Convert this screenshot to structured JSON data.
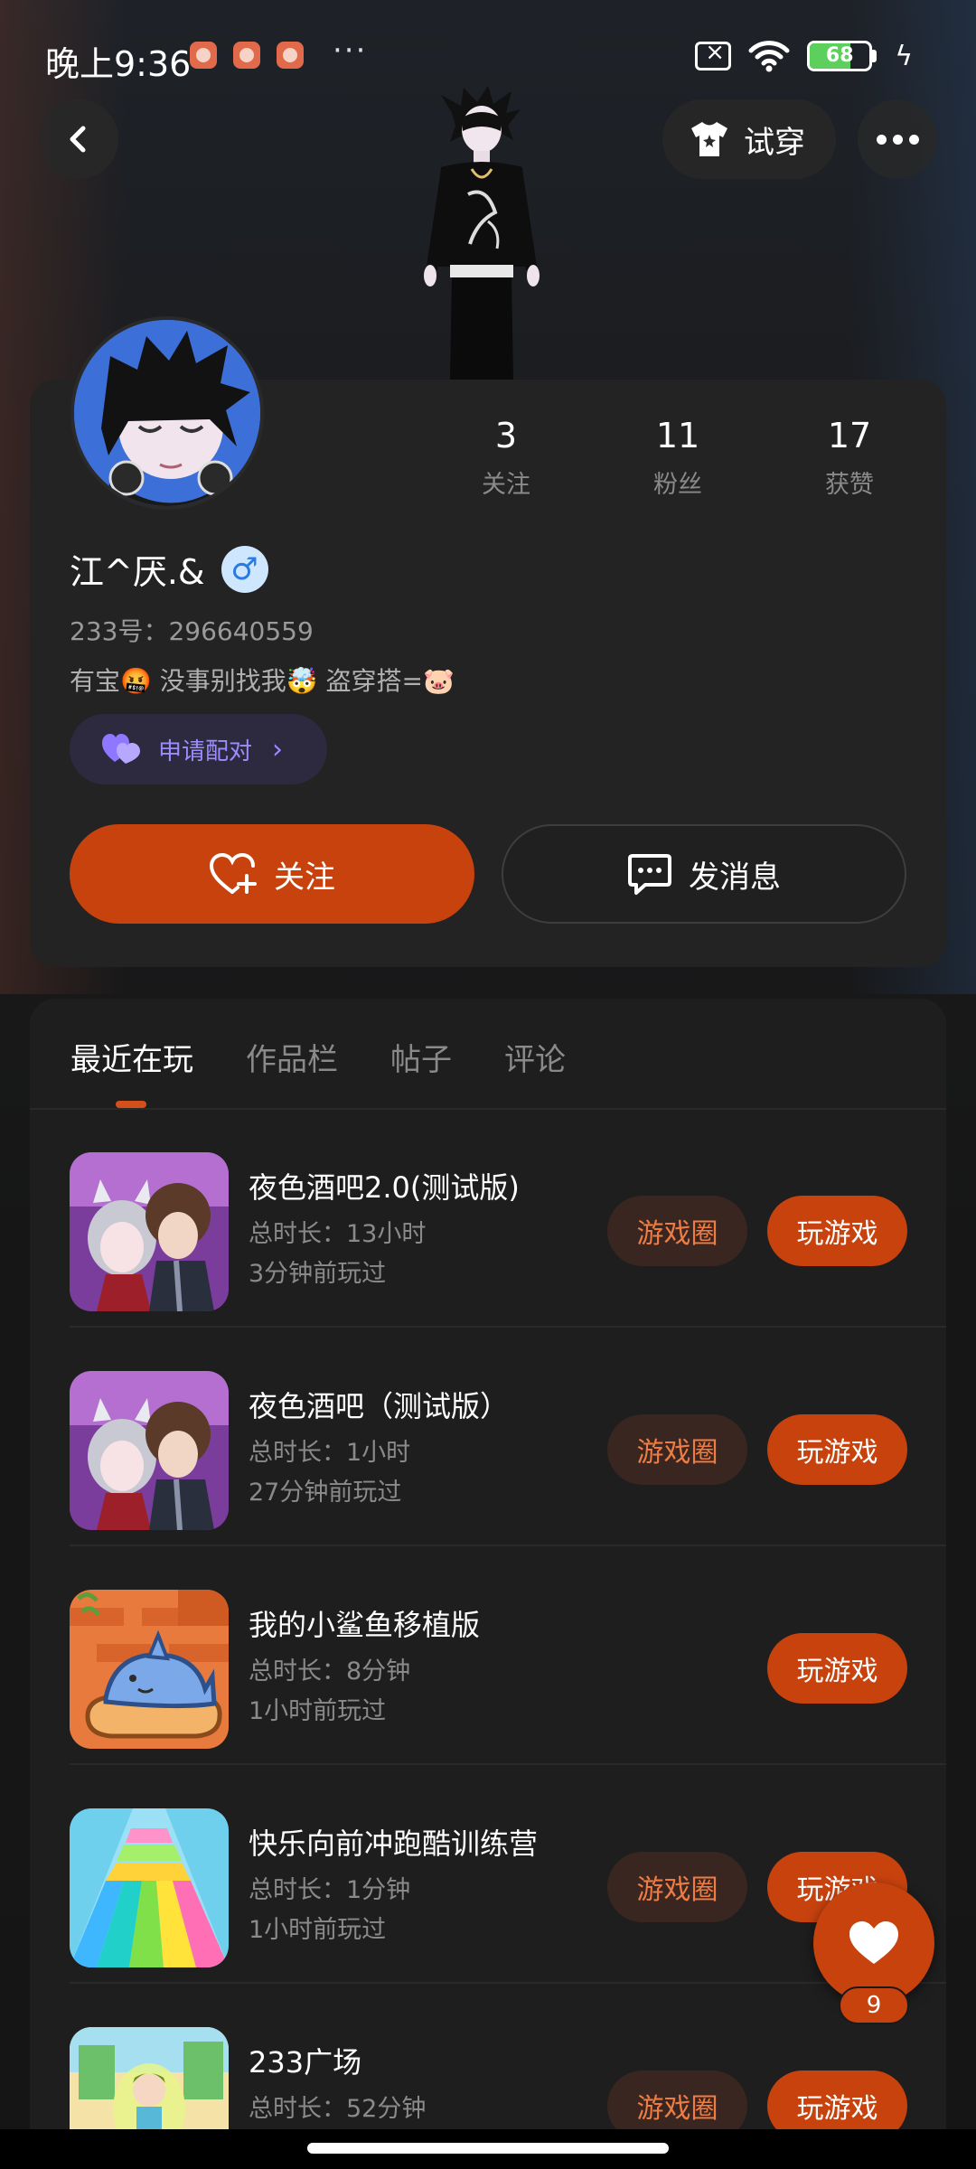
{
  "status_bar": {
    "time": "晚上9:36",
    "more": "···",
    "battery_level": "68",
    "battery_fraction": 0.68
  },
  "nav": {
    "try_on_label": "试穿"
  },
  "profile": {
    "stats": [
      {
        "value": "3",
        "label": "关注"
      },
      {
        "value": "11",
        "label": "粉丝"
      },
      {
        "value": "17",
        "label": "获赞"
      }
    ],
    "username": "江^厌.&",
    "gender_symbol": "♂",
    "account_id": "233号：296640559",
    "bio": "有宝🤬    没事别找我🤯    盗穿搭=🐷",
    "pair_label": "申请配对",
    "follow_label": "关注",
    "message_label": "发消息"
  },
  "tabs": [
    {
      "label": "最近在玩",
      "active": true
    },
    {
      "label": "作品栏",
      "active": false
    },
    {
      "label": "帖子",
      "active": false
    },
    {
      "label": "评论",
      "active": false
    }
  ],
  "games": [
    {
      "title": "夜色酒吧2.0(测试版)",
      "duration": "总时长：13小时",
      "last_played": "3分钟前玩过",
      "circle_label": "游戏圈",
      "play_label": "玩游戏",
      "has_circle": true
    },
    {
      "title": "夜色酒吧（测试版）",
      "duration": "总时长：1小时",
      "last_played": "27分钟前玩过",
      "circle_label": "游戏圈",
      "play_label": "玩游戏",
      "has_circle": true
    },
    {
      "title": "我的小鲨鱼移植版",
      "duration": "总时长：8分钟",
      "last_played": "1小时前玩过",
      "circle_label": "",
      "play_label": "玩游戏",
      "has_circle": false
    },
    {
      "title": "快乐向前冲跑酷训练营",
      "duration": "总时长：1分钟",
      "last_played": "1小时前玩过",
      "circle_label": "游戏圈",
      "play_label": "玩游戏",
      "has_circle": true
    },
    {
      "title": "233广场",
      "duration": "总时长：52分钟",
      "last_played": "",
      "circle_label": "游戏圈",
      "play_label": "玩游戏",
      "has_circle": true
    }
  ],
  "like": {
    "count": "9"
  },
  "colors": {
    "accent": "#c8420e",
    "circle_text": "#ef7d43",
    "pair_purple": "#9b8cff"
  }
}
